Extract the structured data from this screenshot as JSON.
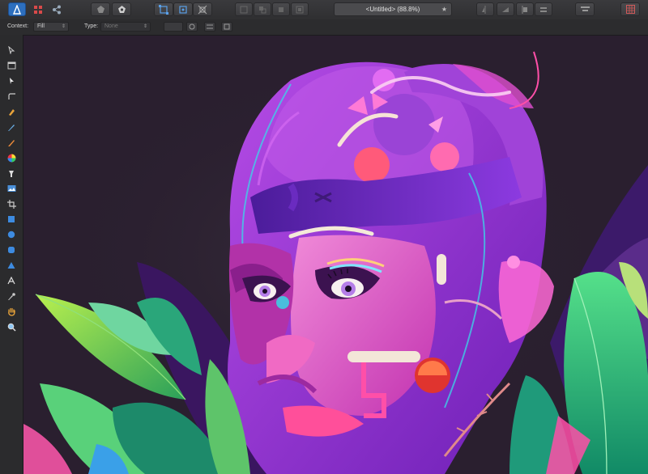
{
  "app": {
    "logo_icon": "affinity-designer-logo-icon"
  },
  "document": {
    "title": "<Untitled> (88.8%)",
    "star": "★"
  },
  "context": {
    "context_label": "Context:",
    "context_value": "Fill",
    "type_label": "Type:",
    "type_value": "None",
    "select_arrow": "⇕"
  },
  "tools": [
    "move-tool-icon",
    "artboard-tool-icon",
    "node-tool-icon",
    "corner-tool-icon",
    "pen-tool-icon",
    "pencil-tool-icon",
    "brush-tool-icon",
    "color-wheel-icon",
    "fill-tool-icon",
    "place-image-icon",
    "crop-tool-icon",
    "rectangle-tool-icon",
    "ellipse-tool-icon",
    "rounded-rect-tool-icon",
    "triangle-tool-icon",
    "text-tool-icon",
    "color-picker-icon",
    "hand-tool-icon",
    "zoom-tool-icon"
  ],
  "colors": {
    "canvas_bg": "#2a1f2f",
    "accent_magenta": "#e33fc6",
    "accent_purple": "#7b2fd0",
    "leaf_green": "#4fc95a"
  }
}
